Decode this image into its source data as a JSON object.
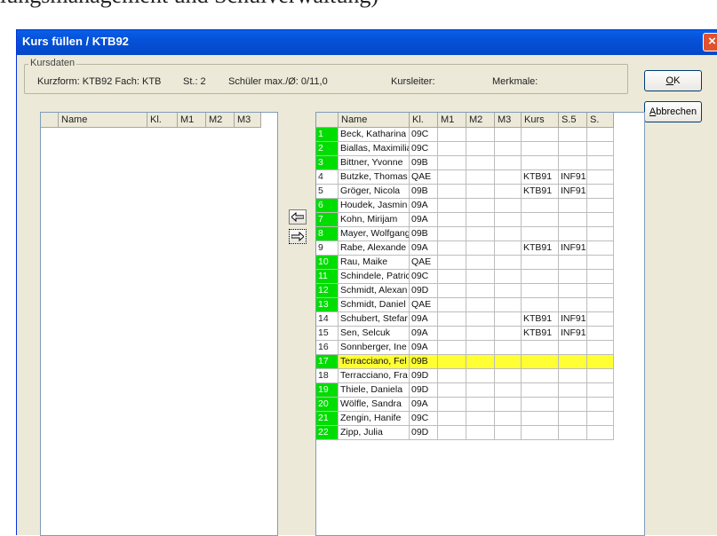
{
  "background_text": "lungsmanagement und Schulverwaltung)",
  "window": {
    "title": "Kurs füllen / KTB92",
    "close_glyph": "×"
  },
  "kursdaten": {
    "legend": "Kursdaten",
    "kurzform": "Kurzform: KTB92 Fach: KTB",
    "st": "St.: 2",
    "schueler": "Schüler max./Ø: 0/11,0",
    "kursleiter": "Kursleiter:",
    "merkmale": "Merkmale:"
  },
  "buttons": {
    "ok": "OK",
    "cancel": "Abbrechen"
  },
  "left_list": {
    "columns": [
      "Name",
      "Kl.",
      "M1",
      "M2",
      "M3"
    ],
    "rows": []
  },
  "right_list": {
    "columns": [
      "",
      "Name",
      "Kl.",
      "M1",
      "M2",
      "M3",
      "Kurs",
      "S.5",
      "S."
    ],
    "rows": [
      {
        "num": "1",
        "name": "Beck, Katharina",
        "kl": "09C",
        "kurs": "",
        "s5": "",
        "green": true
      },
      {
        "num": "2",
        "name": "Biallas, Maximilia",
        "kl": "09C",
        "kurs": "",
        "s5": "",
        "green": true
      },
      {
        "num": "3",
        "name": "Bittner, Yvonne",
        "kl": "09B",
        "kurs": "",
        "s5": "",
        "green": true
      },
      {
        "num": "4",
        "name": "Butzke, Thomas",
        "kl": "QAE",
        "kurs": "KTB91",
        "s5": "INF91",
        "green": false
      },
      {
        "num": "5",
        "name": "Gröger, Nicola",
        "kl": "09B",
        "kurs": "KTB91",
        "s5": "INF91",
        "green": false
      },
      {
        "num": "6",
        "name": "Houdek, Jasmin",
        "kl": "09A",
        "kurs": "",
        "s5": "",
        "green": true
      },
      {
        "num": "7",
        "name": "Kohn, Mirijam",
        "kl": "09A",
        "kurs": "",
        "s5": "",
        "green": true
      },
      {
        "num": "8",
        "name": "Mayer, Wolfgang",
        "kl": "09B",
        "kurs": "",
        "s5": "",
        "green": true
      },
      {
        "num": "9",
        "name": "Rabe, Alexande",
        "kl": "09A",
        "kurs": "KTB91",
        "s5": "INF91",
        "green": false
      },
      {
        "num": "10",
        "name": "Rau, Maike",
        "kl": "QAE",
        "kurs": "",
        "s5": "",
        "green": true
      },
      {
        "num": "11",
        "name": "Schindele, Patric",
        "kl": "09C",
        "kurs": "",
        "s5": "",
        "green": true
      },
      {
        "num": "12",
        "name": "Schmidt, Alexan",
        "kl": "09D",
        "kurs": "",
        "s5": "",
        "green": true
      },
      {
        "num": "13",
        "name": "Schmidt, Daniel",
        "kl": "QAE",
        "kurs": "",
        "s5": "",
        "green": true
      },
      {
        "num": "14",
        "name": "Schubert, Stefar",
        "kl": "09A",
        "kurs": "KTB91",
        "s5": "INF91",
        "green": false
      },
      {
        "num": "15",
        "name": "Sen, Selcuk",
        "kl": "09A",
        "kurs": "KTB91",
        "s5": "INF91",
        "green": false
      },
      {
        "num": "16",
        "name": "Sonnberger, Ine",
        "kl": "09A",
        "kurs": "",
        "s5": "",
        "green": false
      },
      {
        "num": "17",
        "name": "Terracciano, Fel",
        "kl": "09B",
        "kurs": "",
        "s5": "",
        "green": true,
        "selected": true
      },
      {
        "num": "18",
        "name": "Terracciano, Fra",
        "kl": "09D",
        "kurs": "",
        "s5": "",
        "green": false
      },
      {
        "num": "19",
        "name": "Thiele, Daniela",
        "kl": "09D",
        "kurs": "",
        "s5": "",
        "green": true
      },
      {
        "num": "20",
        "name": "Wölfle, Sandra",
        "kl": "09A",
        "kurs": "",
        "s5": "",
        "green": true
      },
      {
        "num": "21",
        "name": "Zengin, Hanife",
        "kl": "09C",
        "kurs": "",
        "s5": "",
        "green": true
      },
      {
        "num": "22",
        "name": "Zipp, Julia",
        "kl": "09D",
        "kurs": "",
        "s5": "",
        "green": true
      }
    ]
  },
  "transfer_buttons": {
    "left_icon": "arrow-left-icon",
    "right_icon": "arrow-right-icon"
  },
  "colors": {
    "title_bar": "#0551d8",
    "row_number_green": "#00dd00",
    "selection_yellow": "#ffff33",
    "close_button": "#e0512e"
  }
}
